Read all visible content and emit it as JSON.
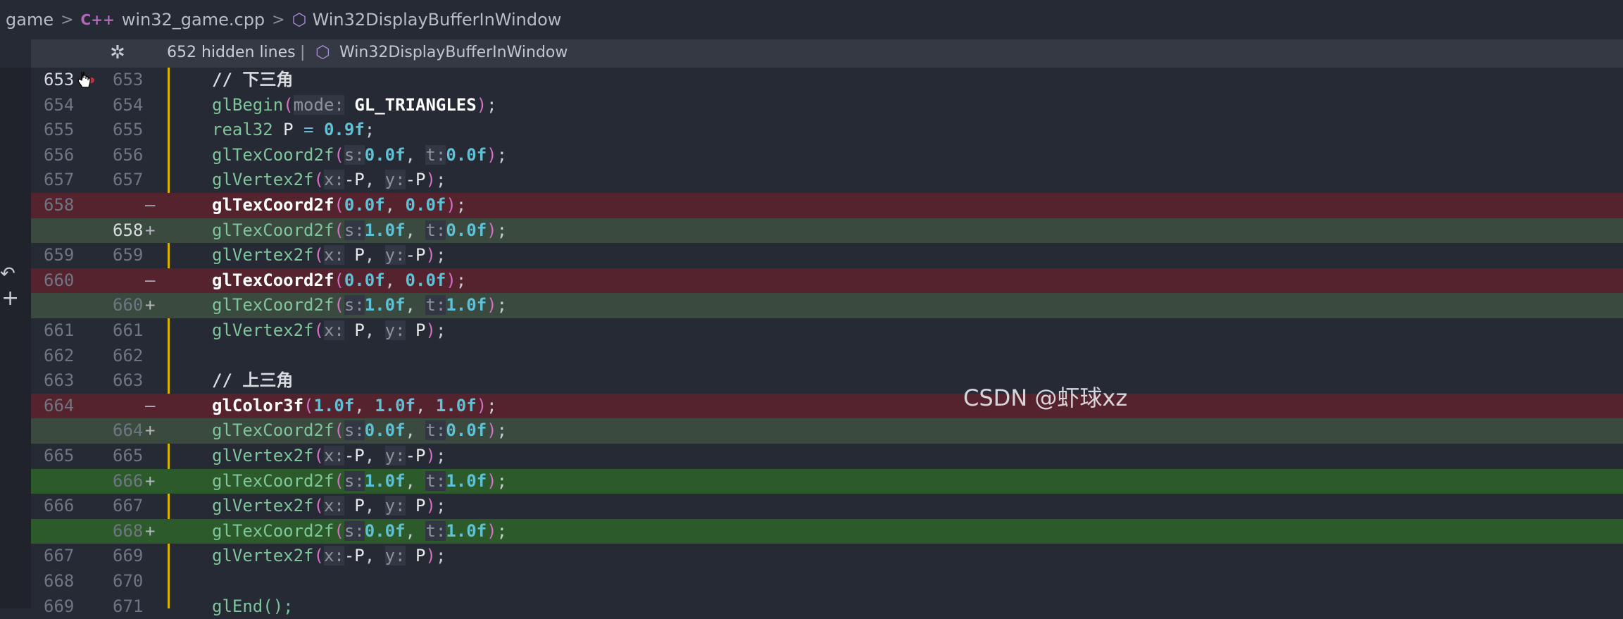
{
  "breadcrumb": {
    "folder": "game",
    "file": "win32_game.cpp",
    "file_icon": "C++",
    "symbol": "Win32DisplayBufferInWindow"
  },
  "hidden_bar": {
    "text": "652 hidden lines",
    "divider": "|",
    "symbol": "Win32DisplayBufferInWindow"
  },
  "lines": [
    {
      "old": "653",
      "new": "653",
      "mark": "",
      "type": "ctx"
    },
    {
      "old": "654",
      "new": "654",
      "mark": "",
      "type": "ctx"
    },
    {
      "old": "655",
      "new": "655",
      "mark": "",
      "type": "ctx"
    },
    {
      "old": "656",
      "new": "656",
      "mark": "",
      "type": "ctx"
    },
    {
      "old": "657",
      "new": "657",
      "mark": "",
      "type": "ctx"
    },
    {
      "old": "658",
      "new": "",
      "mark": "—",
      "type": "del"
    },
    {
      "old": "",
      "new": "658",
      "mark": "+",
      "type": "add"
    },
    {
      "old": "659",
      "new": "659",
      "mark": "",
      "type": "ctx"
    },
    {
      "old": "660",
      "new": "",
      "mark": "—",
      "type": "del"
    },
    {
      "old": "",
      "new": "660",
      "mark": "+",
      "type": "add"
    },
    {
      "old": "661",
      "new": "661",
      "mark": "",
      "type": "ctx"
    },
    {
      "old": "662",
      "new": "662",
      "mark": "",
      "type": "ctx"
    },
    {
      "old": "663",
      "new": "663",
      "mark": "",
      "type": "ctx"
    },
    {
      "old": "664",
      "new": "",
      "mark": "—",
      "type": "del"
    },
    {
      "old": "",
      "new": "664",
      "mark": "+",
      "type": "add"
    },
    {
      "old": "665",
      "new": "665",
      "mark": "",
      "type": "ctx"
    },
    {
      "old": "",
      "new": "666",
      "mark": "+",
      "type": "add-strong"
    },
    {
      "old": "666",
      "new": "667",
      "mark": "",
      "type": "ctx"
    },
    {
      "old": "",
      "new": "668",
      "mark": "+",
      "type": "add-strong"
    },
    {
      "old": "667",
      "new": "669",
      "mark": "",
      "type": "ctx"
    },
    {
      "old": "668",
      "new": "670",
      "mark": "",
      "type": "ctx"
    },
    {
      "old": "669",
      "new": "671",
      "mark": "",
      "type": "ctx"
    }
  ],
  "code": {
    "l653": "// 下三角",
    "l654_fn": "glBegin",
    "l654_hint": "mode:",
    "l654_arg": "GL_TRIANGLES",
    "l655_type": "real32",
    "l655_var": "P",
    "l655_op": "=",
    "l655_val": "0.9f",
    "s_hint": "s:",
    "t_hint": "t:",
    "x_hint": "x:",
    "y_hint": "y:",
    "texcoord": "glTexCoord2f",
    "vertex": "glVertex2f",
    "color": "glColor3f",
    "v00": "0.0f",
    "v10": "1.0f",
    "negP": "-P",
    "P": "P",
    "l663": "// 上三角",
    "l671": "glEnd();"
  },
  "watermark": "CSDN @虾球xz",
  "colors": {
    "background": "#262a34",
    "deleted_line": "#55232e",
    "added_line": "#3b4a3f",
    "added_line_strong": "#2d5a2b",
    "change_bar": "#d8b400"
  }
}
